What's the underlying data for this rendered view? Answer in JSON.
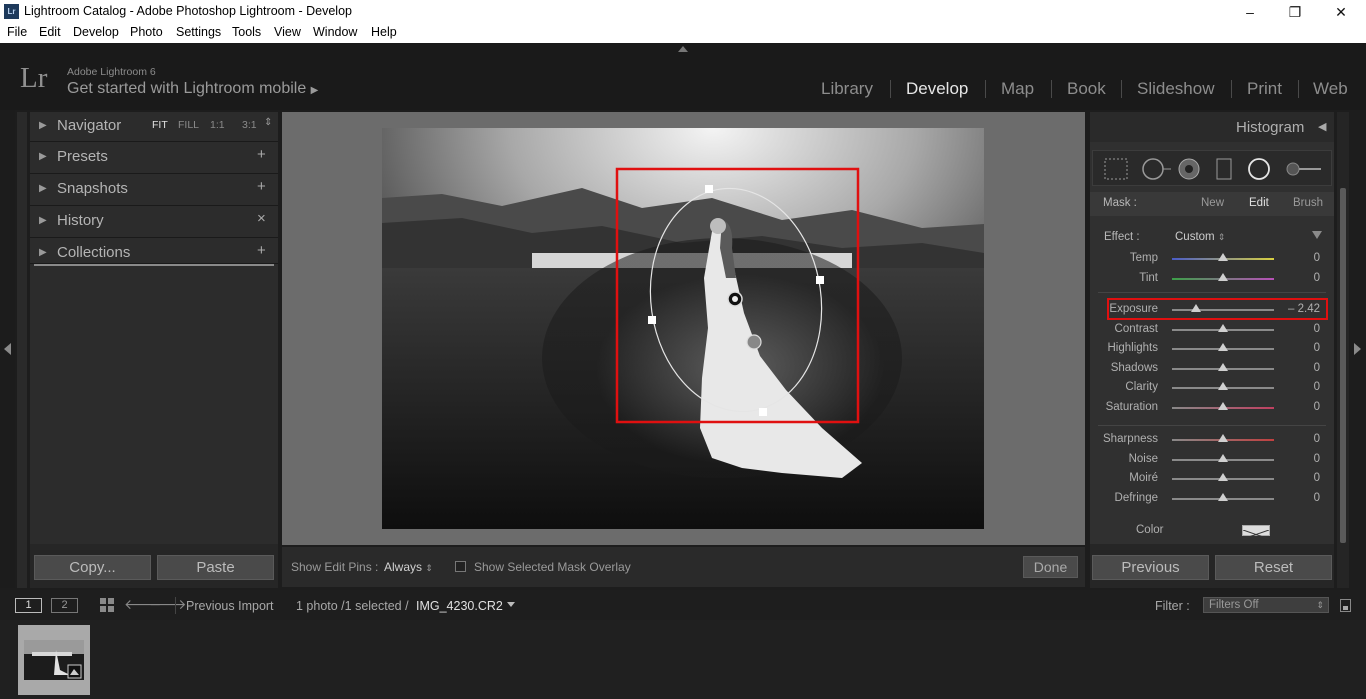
{
  "window": {
    "title": "Lightroom Catalog - Adobe Photoshop Lightroom - Develop",
    "app_icon": "Lr",
    "minimize": "–",
    "restore": "❐",
    "close": "✕"
  },
  "menu": [
    "File",
    "Edit",
    "Develop",
    "Photo",
    "Settings",
    "Tools",
    "View",
    "Window",
    "Help"
  ],
  "identity": {
    "logo": "Lr",
    "product": "Adobe Lightroom 6",
    "mobile": "Get started with Lightroom mobile",
    "mobile_arrow": "▶"
  },
  "modules": [
    "Library",
    "Develop",
    "Map",
    "Book",
    "Slideshow",
    "Print",
    "Web"
  ],
  "active_module": "Develop",
  "left_panel": {
    "navigator": {
      "label": "Navigator",
      "zoom": [
        "FIT",
        "FILL",
        "1:1",
        "3:1"
      ],
      "zoom_selected": "FIT"
    },
    "presets": {
      "label": "Presets",
      "action": "+"
    },
    "snapshots": {
      "label": "Snapshots",
      "action": "+"
    },
    "history": {
      "label": "History",
      "action": "×"
    },
    "collections": {
      "label": "Collections",
      "action": "+"
    },
    "copy_button": "Copy...",
    "paste_button": "Paste"
  },
  "toolbar": {
    "show_pins_label": "Show Edit Pins :",
    "show_pins_value": "Always",
    "mask_overlay_label": "Show Selected Mask Overlay",
    "done_button": "Done"
  },
  "right_panel": {
    "histogram_label": "Histogram",
    "histogram_arrow": "◀",
    "mask_label": "Mask :",
    "mask_options": [
      "New",
      "Edit",
      "Brush"
    ],
    "mask_selected": "Edit",
    "effect_label": "Effect :",
    "effect_value": "Custom",
    "sliders_group1": [
      {
        "name": "Temp",
        "value": "0",
        "pos": 0.5,
        "track": "temp"
      },
      {
        "name": "Tint",
        "value": "0",
        "pos": 0.5,
        "track": "tint"
      }
    ],
    "sliders_group2": [
      {
        "name": "Exposure",
        "value": "– 2.42",
        "pos": 0.24,
        "track": "gray"
      },
      {
        "name": "Contrast",
        "value": "0",
        "pos": 0.5,
        "track": "gray"
      },
      {
        "name": "Highlights",
        "value": "0",
        "pos": 0.5,
        "track": "gray"
      },
      {
        "name": "Shadows",
        "value": "0",
        "pos": 0.5,
        "track": "gray"
      },
      {
        "name": "Clarity",
        "value": "0",
        "pos": 0.5,
        "track": "gray"
      },
      {
        "name": "Saturation",
        "value": "0",
        "pos": 0.5,
        "track": "sat"
      }
    ],
    "sliders_group3": [
      {
        "name": "Sharpness",
        "value": "0",
        "pos": 0.5,
        "track": "sharp"
      },
      {
        "name": "Noise",
        "value": "0",
        "pos": 0.5,
        "track": "gray"
      },
      {
        "name": "Moiré",
        "value": "0",
        "pos": 0.5,
        "track": "gray"
      },
      {
        "name": "Defringe",
        "value": "0",
        "pos": 0.5,
        "track": "gray"
      }
    ],
    "color_label": "Color",
    "previous_button": "Previous",
    "reset_button": "Reset"
  },
  "filmstrip_bar": {
    "screen1": "1",
    "screen2": "2",
    "source": "Previous Import",
    "count": "1 photo /1 selected /",
    "filename": "IMG_4230.CR2",
    "filter_label": "Filter :",
    "filter_value": "Filters Off"
  },
  "colors": {
    "highlight_box": "#e01010",
    "panel_bg": "#2c2c2c",
    "center_bg": "#6c6c6c",
    "active_module": "#e6e6e6"
  }
}
